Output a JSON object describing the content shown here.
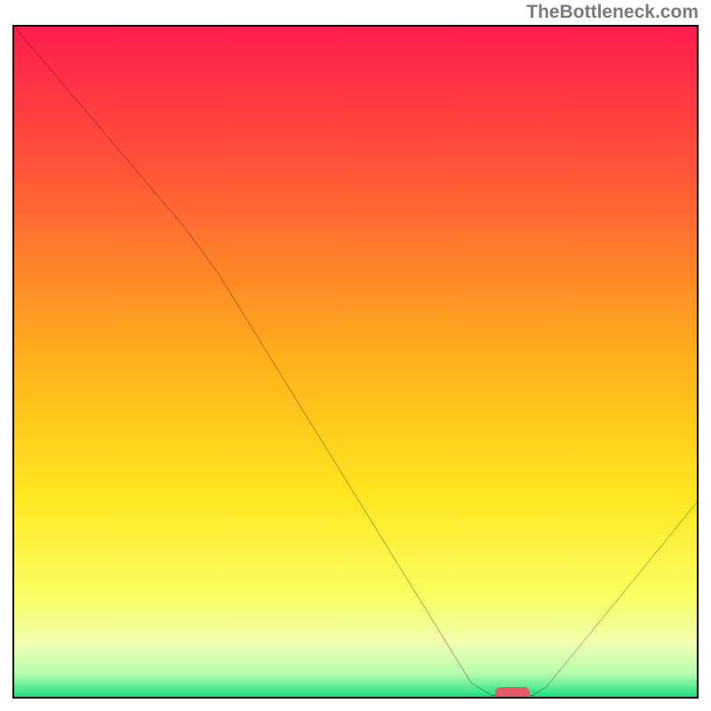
{
  "watermark": "TheBottleneck.com",
  "chart_data": {
    "type": "line",
    "title": "",
    "xlabel": "",
    "ylabel": "",
    "x_range": [
      0,
      100
    ],
    "y_range": [
      0,
      100
    ],
    "gradient_stops": [
      {
        "pct": 0,
        "color": "#ff1d4d"
      },
      {
        "pct": 22,
        "color": "#ff5637"
      },
      {
        "pct": 50,
        "color": "#ffb21a"
      },
      {
        "pct": 70,
        "color": "#ffe61f"
      },
      {
        "pct": 85,
        "color": "#f9ff62"
      },
      {
        "pct": 92,
        "color": "#f0ffb0"
      },
      {
        "pct": 96.5,
        "color": "#b8ffb0"
      },
      {
        "pct": 100,
        "color": "#1cde7f"
      }
    ],
    "curve": [
      {
        "x": 0.0,
        "y": 100.0
      },
      {
        "x": 25.0,
        "y": 70.0
      },
      {
        "x": 30.0,
        "y": 63.0
      },
      {
        "x": 67.0,
        "y": 2.0
      },
      {
        "x": 70.0,
        "y": 0.2
      },
      {
        "x": 76.0,
        "y": 0.2
      },
      {
        "x": 78.0,
        "y": 1.5
      },
      {
        "x": 100.0,
        "y": 29.0
      }
    ],
    "marker": {
      "x": 73.0,
      "y": 0.6,
      "w": 5.0,
      "h": 1.6
    }
  }
}
